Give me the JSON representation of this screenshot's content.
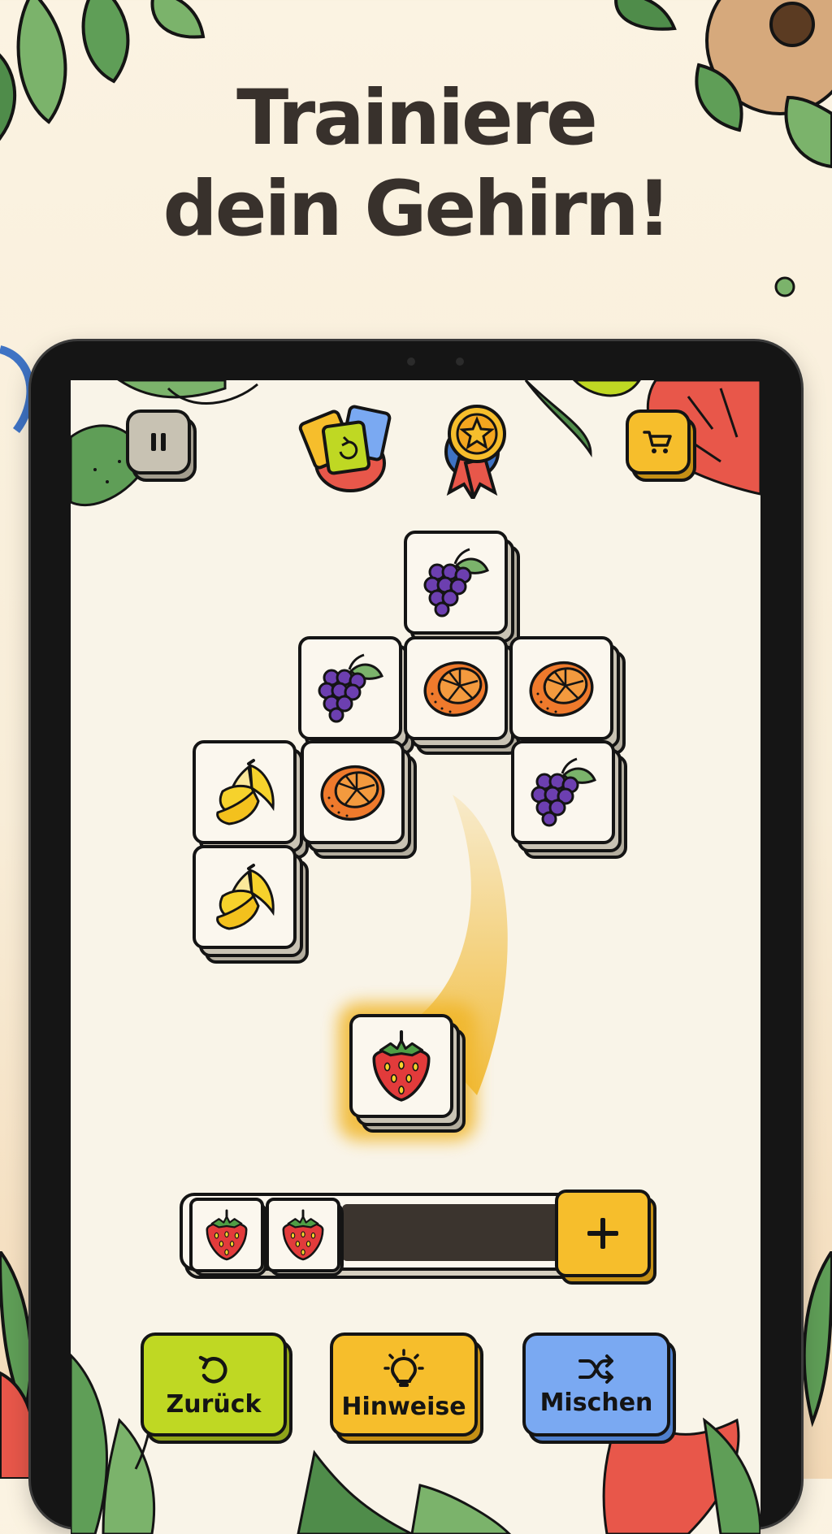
{
  "headline": {
    "line1": "Trainiere",
    "line2": "dein Gehirn!"
  },
  "colors": {
    "background": "#fbf3e2",
    "text": "#38312c",
    "back_button": "#bfd823",
    "hint_button": "#f6be2c",
    "shuffle_button": "#7aa9f2",
    "shop_button": "#f6be2c",
    "pause_button": "#c8c2b3",
    "highlight": "#f0b62a"
  },
  "top_bar": {
    "pause_icon": "pause-icon",
    "cards_icon": "cards-icon",
    "medal_icon": "medal-icon",
    "shop_icon": "cart-icon"
  },
  "board": {
    "tiles": [
      "grapes",
      "grapes",
      "orange",
      "orange",
      "banana",
      "orange",
      "grapes",
      "banana"
    ],
    "moving_tile": "strawberry"
  },
  "tray": {
    "slots": [
      "strawberry",
      "strawberry"
    ],
    "add_icon": "plus-icon"
  },
  "actions": {
    "undo": {
      "label": "Zurück",
      "icon": "undo-icon"
    },
    "hints": {
      "label": "Hinweise",
      "icon": "lightbulb-icon"
    },
    "shuffle": {
      "label": "Mischen",
      "icon": "shuffle-icon"
    }
  }
}
